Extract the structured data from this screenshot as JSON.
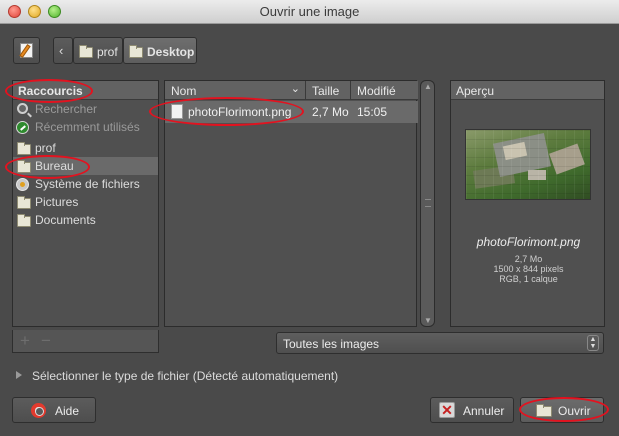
{
  "window": {
    "title": "Ouvrir une image"
  },
  "path_bar": {
    "crumbs": [
      "prof",
      "Desktop"
    ]
  },
  "sidebar": {
    "header": "Raccourcis",
    "items": [
      {
        "label": "Rechercher",
        "icon": "search-icon"
      },
      {
        "label": "Récemment utilisés",
        "icon": "recent-icon"
      },
      {
        "label": "prof",
        "icon": "folder-icon"
      },
      {
        "label": "Bureau",
        "icon": "folder-icon"
      },
      {
        "label": "Système de fichiers",
        "icon": "filesystem-icon"
      },
      {
        "label": "Pictures",
        "icon": "folder-icon"
      },
      {
        "label": "Documents",
        "icon": "folder-icon"
      }
    ],
    "add_symbol": "+",
    "remove_symbol": "−"
  },
  "files": {
    "columns": [
      "Nom",
      "Taille",
      "Modifié"
    ],
    "rows": [
      {
        "name": "photoFlorimont.png",
        "size": "2,7 Mo",
        "modified": "15:05"
      }
    ]
  },
  "preview": {
    "header": "Aperçu",
    "filename": "photoFlorimont.png",
    "size": "2,7 Mo",
    "dimensions": "1500 x 844 pixels",
    "info": "RGB, 1 calque"
  },
  "filter": {
    "selected": "Toutes les images"
  },
  "expander": {
    "label": "Sélectionner le type de fichier (Détecté automatiquement)"
  },
  "buttons": {
    "help": "Aide",
    "cancel": "Annuler",
    "open": "Ouvrir"
  },
  "colors": {
    "annotation": "#e3121f",
    "window_bg": "#4a4a4a",
    "selection": "#6a6a6a"
  }
}
